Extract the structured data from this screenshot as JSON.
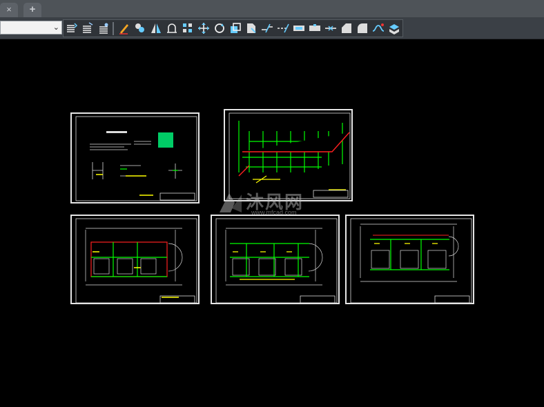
{
  "tabs": {
    "close_glyph": "×",
    "add_glyph": "+"
  },
  "toolbar": {
    "layer_dropdown_value": "",
    "buttons": [
      "layer-states-icon",
      "layer-match-icon",
      "layer-previous-icon",
      "draw-pencil-icon",
      "join-icon",
      "mirror-icon",
      "offset-icon",
      "array-icon",
      "move-icon",
      "rotate-icon",
      "scale-icon",
      "stretch-icon",
      "trim-icon",
      "extend-icon",
      "break-icon",
      "break-at-point-icon",
      "join-lines-icon",
      "chamfer-icon",
      "fillet-icon",
      "blend-icon",
      "explode-icon"
    ]
  },
  "watermark": {
    "text": "沐风网",
    "url": "www.mfcad.com"
  },
  "colors": {
    "sheet_border": "#e6e6e6",
    "pipe_green": "#00ff00",
    "pipe_yellow": "#ffff00",
    "pipe_red": "#ff2020",
    "toolbar_bg": "#3b4046"
  }
}
